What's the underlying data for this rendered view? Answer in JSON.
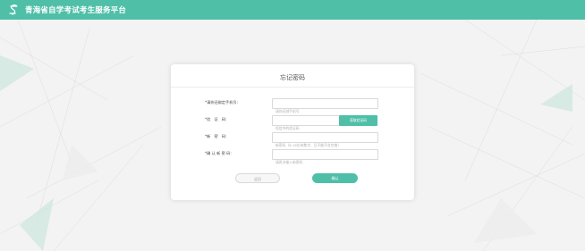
{
  "header": {
    "title": "青海省自学考试考生服务平台",
    "logo_icon": "s-logo-icon"
  },
  "colors": {
    "brand": "#4fbfa8",
    "background": "#f3f3f3"
  },
  "card": {
    "title": "忘记密码",
    "fields": [
      {
        "label": "*请你还绑定手机号:",
        "placeholder": "请你还绑手机号"
      },
      {
        "label": "*验　证　码:",
        "placeholder": "短信中的验证码"
      },
      {
        "label": "*新　密　码:",
        "placeholder": "新密码（6-16位有数字、且不能不含空格）"
      },
      {
        "label": "*确 认 新 密 码:",
        "placeholder": "请再次输入新密码"
      }
    ],
    "get_code_label": "获取验证码",
    "back_label": "返回",
    "confirm_label": "确认"
  }
}
